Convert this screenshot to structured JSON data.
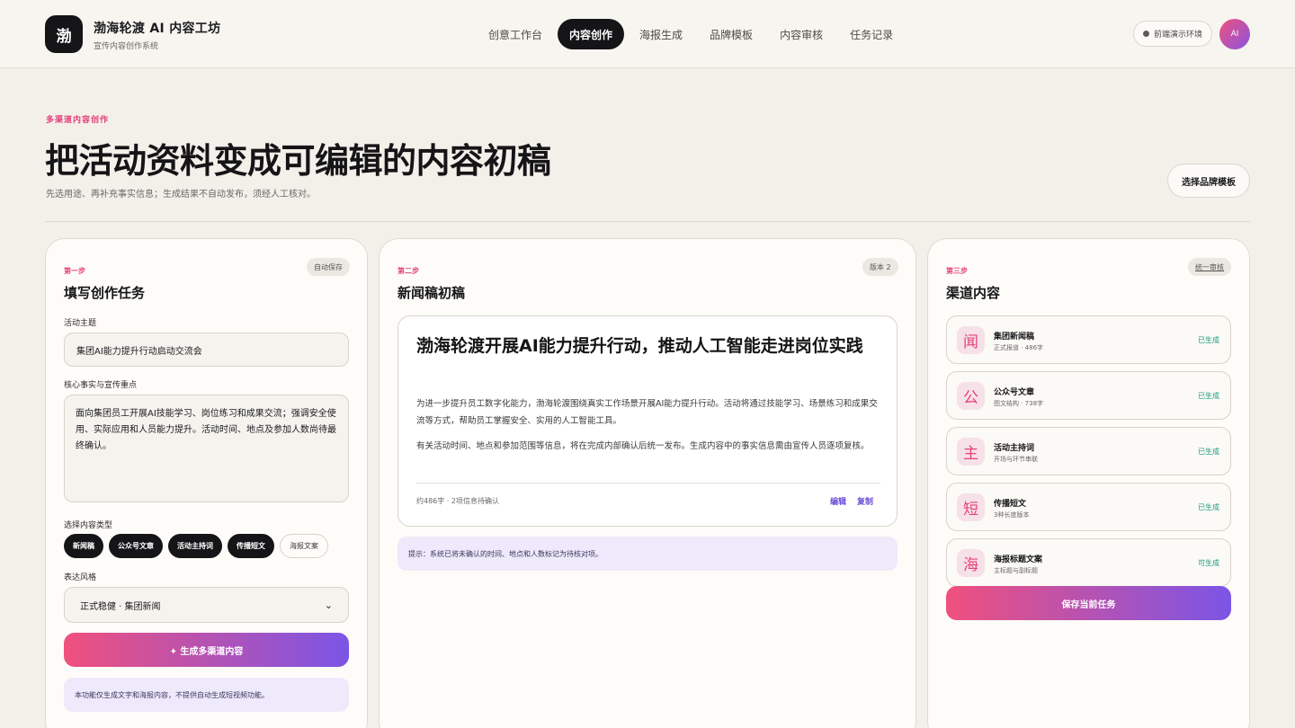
{
  "header": {
    "logo_text": "渤",
    "title": "渤海轮渡 AI 内容工坊",
    "subtitle": "宣传内容创作系统",
    "nav": [
      {
        "label": "创意工作台"
      },
      {
        "label": "内容创作",
        "active": true
      },
      {
        "label": "海报生成"
      },
      {
        "label": "品牌模板"
      },
      {
        "label": "内容审核"
      },
      {
        "label": "任务记录"
      }
    ],
    "env_label": "前端演示环境",
    "avatar_text": "AI"
  },
  "hero": {
    "eyebrow": "多渠道内容创作",
    "title": "把活动资料变成可编辑的内容初稿",
    "subtitle": "先选用途、再补充事实信息；生成结果不自动发布，须经人工核对。",
    "brand_button": "选择品牌模板"
  },
  "step1": {
    "step": "第一步",
    "title": "填写创作任务",
    "tag": "自动保存",
    "topic_label": "活动主题",
    "topic_value": "集团AI能力提升行动启动交流会",
    "facts_label": "核心事实与宣传重点",
    "facts_value": "面向集团员工开展AI技能学习、岗位练习和成果交流；强调安全使用、实际应用和人员能力提升。活动时间、地点及参加人数尚待最终确认。",
    "types_label": "选择内容类型",
    "types": [
      {
        "label": "新闻稿",
        "selected": true
      },
      {
        "label": "公众号文章",
        "selected": true
      },
      {
        "label": "活动主持词",
        "selected": true
      },
      {
        "label": "传播短文",
        "selected": true
      },
      {
        "label": "海报文案",
        "selected": false
      }
    ],
    "style_label": "表达风格",
    "style_value": "正式稳健 · 集团新闻",
    "generate_button": "✦ 生成多渠道内容",
    "note": "本功能仅生成文字和海报内容，不提供自动生成短视频功能。"
  },
  "step2": {
    "step": "第二步",
    "title": "新闻稿初稿",
    "tag": "版本 2",
    "article_title": "渤海轮渡开展AI能力提升行动，推动人工智能走进岗位实践",
    "paragraph1": "为进一步提升员工数字化能力，渤海轮渡围绕真实工作场景开展AI能力提升行动。活动将通过技能学习、场景练习和成果交流等方式，帮助员工掌握安全、实用的人工智能工具。",
    "paragraph2": "有关活动时间、地点和参加范围等信息，将在完成内部确认后统一发布。生成内容中的事实信息需由宣传人员逐项复核。",
    "meta": "约486字 · 2项信息待确认",
    "edit_link": "编辑",
    "copy_link": "复制",
    "hint": "提示：系统已将未确认的时间、地点和人数标记为待核对项。"
  },
  "step3": {
    "step": "第三步",
    "title": "渠道内容",
    "tag": "统一审核",
    "channels": [
      {
        "icon": "闻",
        "name": "集团新闻稿",
        "meta": "正式报道 · 486字",
        "status": "已生成"
      },
      {
        "icon": "公",
        "name": "公众号文章",
        "meta": "图文结构 · 738字",
        "status": "已生成"
      },
      {
        "icon": "主",
        "name": "活动主持词",
        "meta": "开场与环节串联",
        "status": "已生成"
      },
      {
        "icon": "短",
        "name": "传播短文",
        "meta": "3种长度版本",
        "status": "已生成"
      },
      {
        "icon": "海",
        "name": "海报标题文案",
        "meta": "主标题与副标题",
        "status": "可生成"
      }
    ],
    "save_button": "保存当前任务"
  },
  "colors": {
    "accent_pink": "#e5407a",
    "accent_purple": "#7b55e6",
    "status_green": "#1d9a7a",
    "dark": "#151417"
  }
}
